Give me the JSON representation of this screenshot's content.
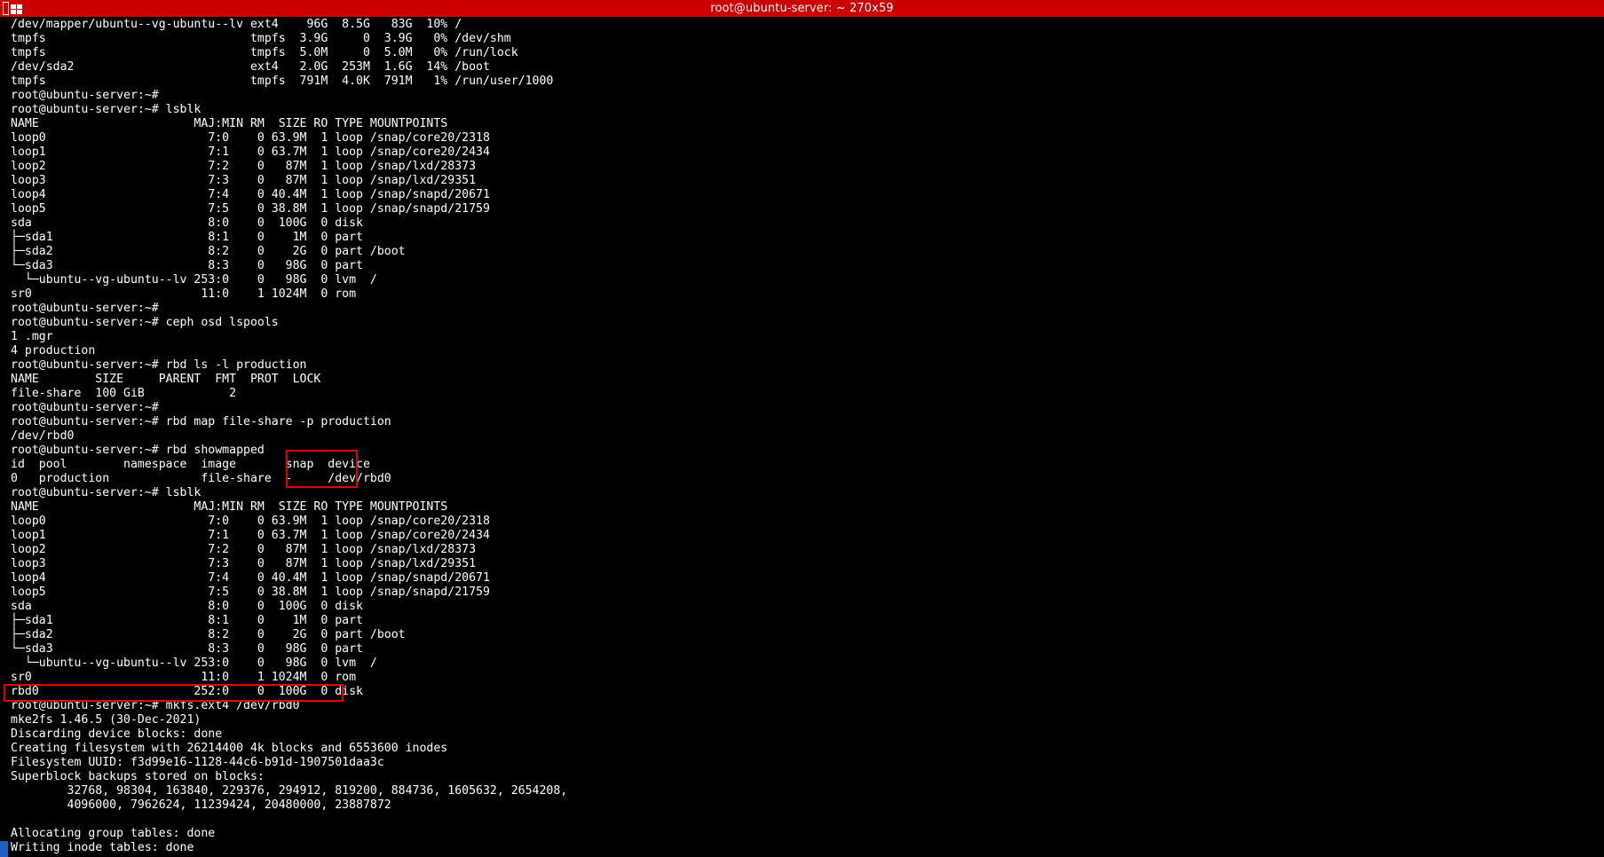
{
  "window": {
    "title": "root@ubuntu-server: ~ 270x59",
    "icon": "terminal-icon",
    "titlebar_color": "#cc0000",
    "highlight_color": "#e00000"
  },
  "terminal": {
    "lines": [
      "/dev/mapper/ubuntu--vg-ubuntu--lv ext4    96G  8.5G   83G  10% /",
      "tmpfs                             tmpfs  3.9G     0  3.9G   0% /dev/shm",
      "tmpfs                             tmpfs  5.0M     0  5.0M   0% /run/lock",
      "/dev/sda2                         ext4   2.0G  253M  1.6G  14% /boot",
      "tmpfs                             tmpfs  791M  4.0K  791M   1% /run/user/1000",
      "root@ubuntu-server:~#",
      "root@ubuntu-server:~# lsblk",
      "NAME                      MAJ:MIN RM  SIZE RO TYPE MOUNTPOINTS",
      "loop0                       7:0    0 63.9M  1 loop /snap/core20/2318",
      "loop1                       7:1    0 63.7M  1 loop /snap/core20/2434",
      "loop2                       7:2    0   87M  1 loop /snap/lxd/28373",
      "loop3                       7:3    0   87M  1 loop /snap/lxd/29351",
      "loop4                       7:4    0 40.4M  1 loop /snap/snapd/20671",
      "loop5                       7:5    0 38.8M  1 loop /snap/snapd/21759",
      "sda                         8:0    0  100G  0 disk",
      "├─sda1                      8:1    0    1M  0 part",
      "├─sda2                      8:2    0    2G  0 part /boot",
      "└─sda3                      8:3    0   98G  0 part",
      "  └─ubuntu--vg-ubuntu--lv 253:0    0   98G  0 lvm  /",
      "sr0                        11:0    1 1024M  0 rom",
      "root@ubuntu-server:~#",
      "root@ubuntu-server:~# ceph osd lspools",
      "1 .mgr",
      "4 production",
      "root@ubuntu-server:~# rbd ls -l production",
      "NAME        SIZE     PARENT  FMT  PROT  LOCK",
      "file-share  100 GiB            2",
      "root@ubuntu-server:~#",
      "root@ubuntu-server:~# rbd map file-share -p production",
      "/dev/rbd0",
      "root@ubuntu-server:~# rbd showmapped",
      "id  pool        namespace  image       snap  device",
      "0   production             file-share  -     /dev/rbd0",
      "root@ubuntu-server:~# lsblk",
      "NAME                      MAJ:MIN RM  SIZE RO TYPE MOUNTPOINTS",
      "loop0                       7:0    0 63.9M  1 loop /snap/core20/2318",
      "loop1                       7:1    0 63.7M  1 loop /snap/core20/2434",
      "loop2                       7:2    0   87M  1 loop /snap/lxd/28373",
      "loop3                       7:3    0   87M  1 loop /snap/lxd/29351",
      "loop4                       7:4    0 40.4M  1 loop /snap/snapd/20671",
      "loop5                       7:5    0 38.8M  1 loop /snap/snapd/21759",
      "sda                         8:0    0  100G  0 disk",
      "├─sda1                      8:1    0    1M  0 part",
      "├─sda2                      8:2    0    2G  0 part /boot",
      "└─sda3                      8:3    0   98G  0 part",
      "  └─ubuntu--vg-ubuntu--lv 253:0    0   98G  0 lvm  /",
      "sr0                        11:0    1 1024M  0 rom",
      "rbd0                      252:0    0  100G  0 disk",
      "root@ubuntu-server:~# mkfs.ext4 /dev/rbd0",
      "mke2fs 1.46.5 (30-Dec-2021)",
      "Discarding device blocks: done",
      "Creating filesystem with 26214400 4k blocks and 6553600 inodes",
      "Filesystem UUID: f3d99e16-1128-44c6-b91d-1907501daa3c",
      "Superblock backups stored on blocks:",
      "        32768, 98304, 163840, 229376, 294912, 819200, 884736, 1605632, 2654208,",
      "        4096000, 7962624, 11239424, 20480000, 23887872",
      "",
      "Allocating group tables: done",
      "Writing inode tables: done"
    ]
  }
}
